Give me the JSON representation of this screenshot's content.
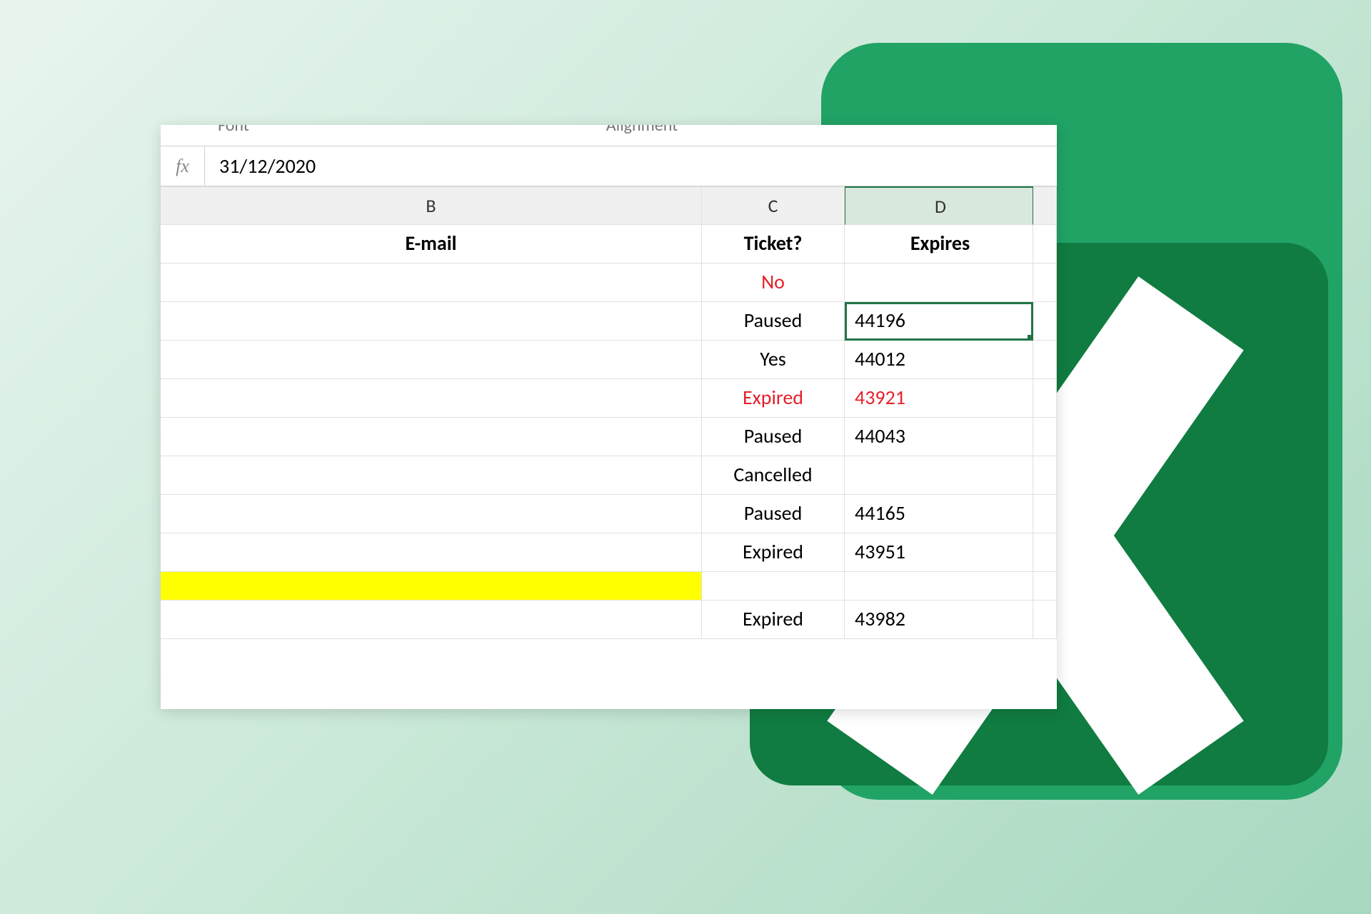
{
  "ribbon": {
    "font_group": "Font",
    "alignment_group": "Alignment"
  },
  "formula_bar": {
    "fx": "fx",
    "value": "31/12/2020"
  },
  "columns": {
    "B": "B",
    "C": "C",
    "D": "D"
  },
  "headers": {
    "email": "E-mail",
    "ticket": "Ticket?",
    "expires": "Expires"
  },
  "rows": [
    {
      "email": "",
      "ticket": "No",
      "expires": "",
      "ticket_red": true
    },
    {
      "email": "",
      "ticket": "Paused",
      "expires": "44196",
      "selected": true
    },
    {
      "email": "",
      "ticket": "Yes",
      "expires": "44012"
    },
    {
      "email": "",
      "ticket": "Expired",
      "expires": "43921",
      "ticket_red": true,
      "expires_red": true
    },
    {
      "email": "",
      "ticket": "Paused",
      "expires": "44043"
    },
    {
      "email": "",
      "ticket": "Cancelled",
      "expires": ""
    },
    {
      "email": "",
      "ticket": "Paused",
      "expires": "44165"
    },
    {
      "email": "",
      "ticket": "Expired",
      "expires": "43951"
    },
    {
      "email": "",
      "ticket": "",
      "expires": "",
      "yellow": true,
      "small": true
    },
    {
      "email": "",
      "ticket": "Expired",
      "expires": "43982"
    }
  ]
}
